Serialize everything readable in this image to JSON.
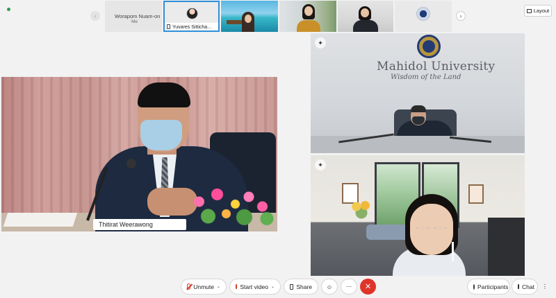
{
  "thumbnails": [
    {
      "name": "Worapom Nuam-on",
      "subtitle": "Me"
    },
    {
      "name": "Yuvares Sitticha...",
      "active": true
    }
  ],
  "layout_label": "Layout",
  "main_speaker": {
    "name": "Thitirat Weerawong"
  },
  "room_sign": {
    "title": "Mahidol University",
    "motto": "Wisdom of the Land"
  },
  "toolbar": {
    "unmute": "Unmute",
    "start_video": "Start video",
    "share": "Share",
    "participants": "Participants",
    "chat": "Chat"
  },
  "icons": [
    "record-dot",
    "chevron-left-icon",
    "chevron-right-icon",
    "microphone-off-icon",
    "video-off-icon",
    "share-icon",
    "reactions-icon",
    "more-icon",
    "leave-icon",
    "participants-icon",
    "chat-icon",
    "pin-icon",
    "layout-icon"
  ],
  "colors": {
    "accent": "#2f8fd8",
    "danger": "#e0342a",
    "muted_red": "#d93a2b"
  }
}
